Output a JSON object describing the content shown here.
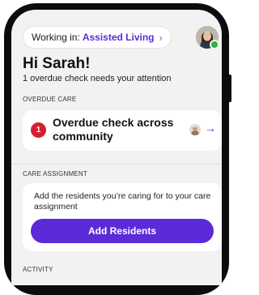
{
  "header": {
    "location_prefix": "Working in:",
    "location_name": "Assisted Living",
    "location_chevron": "›",
    "avatar_icon": "user-avatar-icon",
    "status": "online"
  },
  "greeting": {
    "title": "Hi Sarah!",
    "subtitle": "1 overdue check needs your attention"
  },
  "overdue_care": {
    "section_label": "OVERDUE CARE",
    "count": "1",
    "title": "Overdue check across community",
    "arrow": "→"
  },
  "care_assignment": {
    "section_label": "CARE ASSIGNMENT",
    "description": "Add the residents you’re caring for to your care assignment",
    "button_label": "Add Residents"
  },
  "activity": {
    "section_label": "ACTIVITY"
  },
  "colors": {
    "accent": "#5b2bd9",
    "alert": "#d32030",
    "online": "#2fb344"
  }
}
